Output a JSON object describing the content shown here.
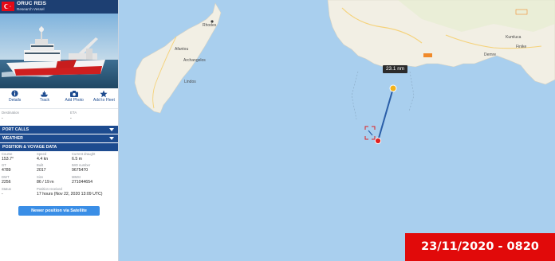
{
  "vessel": {
    "name": "ORUC REIS",
    "type": "Research Vessel",
    "flag_color": "#e30a17"
  },
  "actions": [
    {
      "label": "Details",
      "icon": "info-icon"
    },
    {
      "label": "Track",
      "icon": "ship-track-icon"
    },
    {
      "label": "Add Photo",
      "icon": "camera-icon"
    },
    {
      "label": "Add to Fleet",
      "icon": "star-icon"
    }
  ],
  "destination": {
    "label": "Destination",
    "value": "-"
  },
  "eta": {
    "label": "ETA",
    "value": "-"
  },
  "sections": {
    "port_calls": "PORT CALLS",
    "weather": "WEATHER",
    "position": "POSITION & VOYAGE DATA"
  },
  "voyage": {
    "course_label": "Course",
    "course": "153.7°",
    "speed_label": "Speed",
    "speed": "4.4 kn",
    "draught_label": "Current draught",
    "draught": "6.5 m",
    "gt_label": "GT",
    "gt": "4789",
    "built_label": "Built",
    "built": "2017",
    "imo_label": "IMO number",
    "imo": "9675470",
    "dwt_label": "DWT",
    "dwt": "2256",
    "size_label": "Size",
    "size": "86 / 19 m",
    "mmsi_label": "MMSI",
    "mmsi": "271044654",
    "status_label": "Status",
    "status": "-",
    "received_label": "Position received",
    "received": "17 hours (Nov 22, 2020 13:09 UTC)"
  },
  "satellite_button": "Newer position via Satellite",
  "map": {
    "places": {
      "rhodes": "Rhodes",
      "afantou": "Afantou",
      "archangelos": "Archangelos",
      "lindos": "Lindos",
      "kumluca": "Kumluca",
      "finike": "Finike",
      "demre": "Demre"
    },
    "distance": "23.1 nm",
    "land_color": "#f2efe4",
    "sea_color": "#a9cfee",
    "track_color": "#2a5ea8"
  },
  "timestamp": "23/11/2020 - 0820"
}
